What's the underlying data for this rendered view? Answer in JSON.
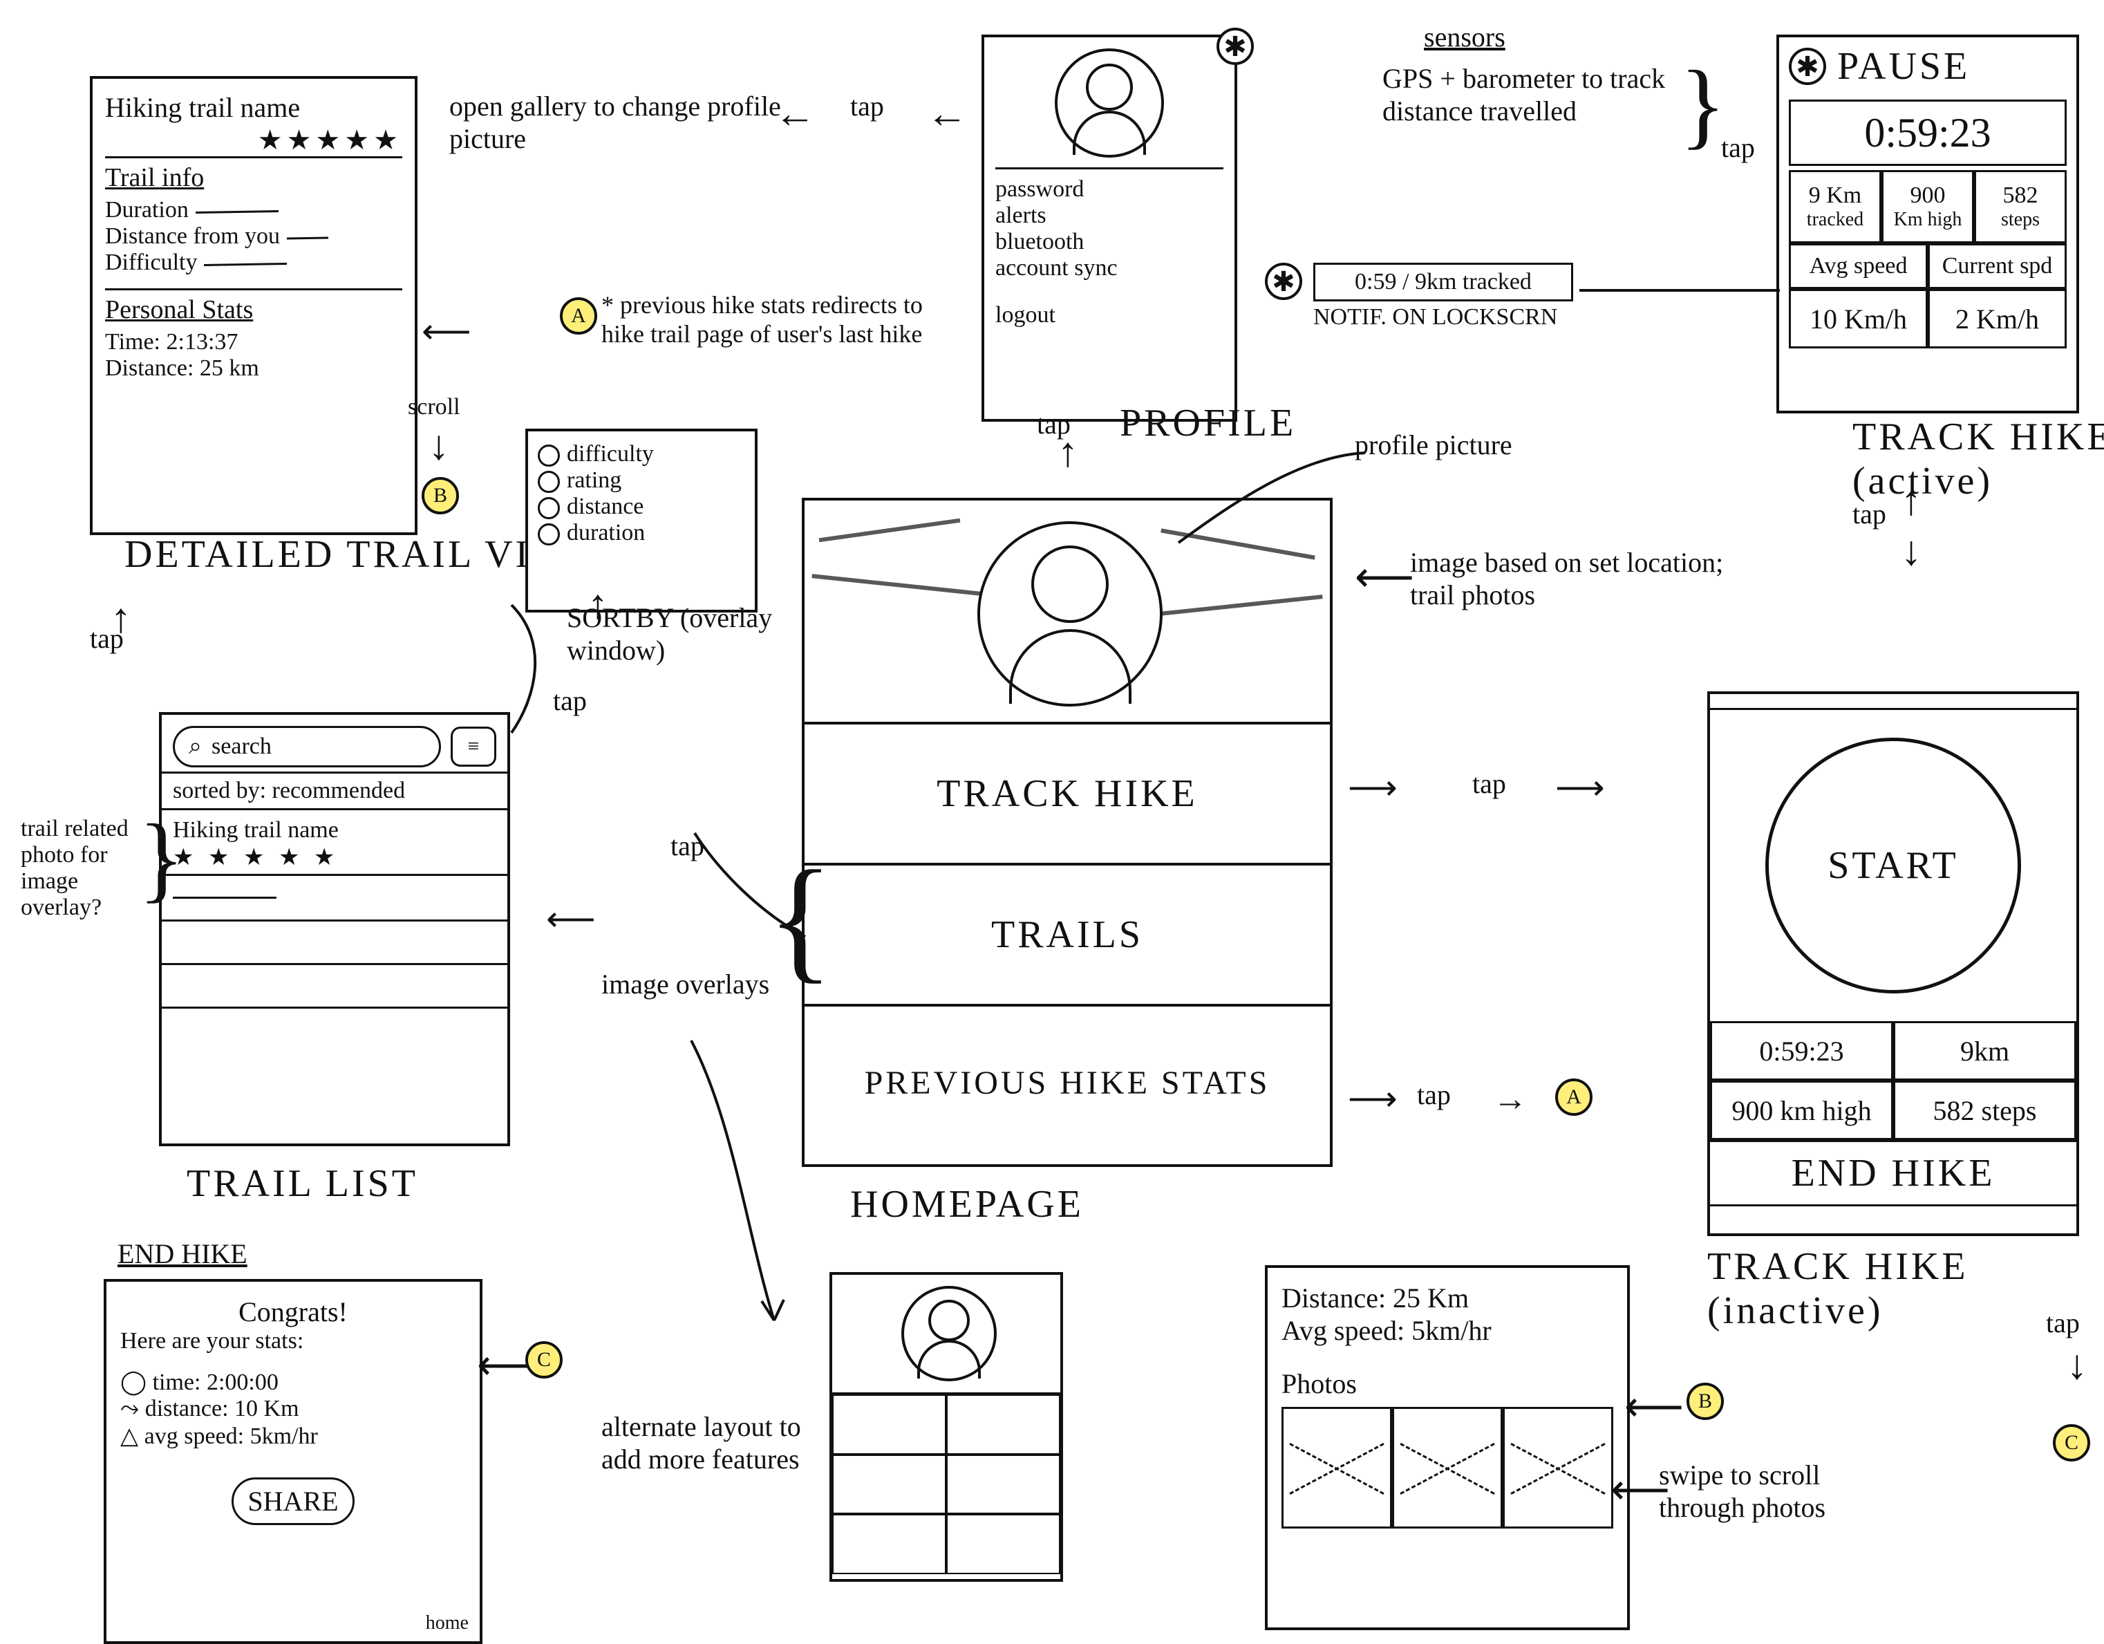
{
  "detail": {
    "title": "Hiking trail name",
    "stars": "★★★★★",
    "info_h": "Trail info",
    "duration": "Duration",
    "distfrom": "Distance from you",
    "difficulty": "Difficulty",
    "ps_h": "Personal Stats",
    "time": "Time: 2:13:37",
    "dist": "Distance: 25 km",
    "caption": "DETAILED TRAIL VIEW",
    "scroll": "scroll"
  },
  "sortby": {
    "o1": "difficulty",
    "o2": "rating",
    "o3": "distance",
    "o4": "duration",
    "caption": "SORTBY (overlay window)"
  },
  "list": {
    "search": "search",
    "sorted": "sorted by: recommended",
    "item": "Hiking trail name",
    "stars": "★ ★ ★ ★ ★",
    "caption": "TRAIL LIST",
    "sidenote": "trail related photo for image overlay?"
  },
  "endhike": {
    "h": "END HIKE",
    "congrats": "Congrats!",
    "sub": "Here are your stats:",
    "time": "time: 2:00:00",
    "dist": "distance: 10 Km",
    "avg": "avg speed: 5km/hr",
    "share": "SHARE",
    "home": "home"
  },
  "profile": {
    "p1": "password",
    "p2": "alerts",
    "p3": "bluetooth",
    "p4": "account sync",
    "p5": "logout",
    "caption": "PROFILE"
  },
  "home": {
    "b1": "TRACK HIKE",
    "b2": "TRAILS",
    "b3": "PREVIOUS HIKE STATS",
    "caption": "HOMEPAGE"
  },
  "altlayout": "alternate layout to add more features",
  "notes": {
    "opengallery": "open gallery to change profile picture",
    "tap": "tap",
    "prevhike": "* previous hike stats redirects to hike trail page of user's last hike",
    "imageoverlays": "image overlays",
    "sensors_h": "sensors",
    "sensors": "GPS + barometer to track distance travelled",
    "imagebased": "image based on set location; trail photos",
    "profilepic": "profile picture",
    "swipe": "swipe to scroll through photos",
    "notif": "NOTIF. ON LOCKSCRN",
    "notifval": "0:59 / 9km tracked"
  },
  "active": {
    "pause": "PAUSE",
    "timer": "0:59:23",
    "c1a": "9 Km",
    "c1b": "tracked",
    "c2a": "900",
    "c2b": "Km high",
    "c3a": "582",
    "c3b": "steps",
    "r2a": "Avg speed",
    "r2b": "Current spd",
    "r3a": "10 Km/h",
    "r3b": "2 Km/h",
    "caption": "TRACK HIKE (active)"
  },
  "inactive": {
    "start": "START",
    "t1": "0:59:23",
    "t2": "9km",
    "t3": "900 km high",
    "t4": "582 steps",
    "end": "END HIKE",
    "caption": "TRACK HIKE (inactive)"
  },
  "prevstats": {
    "dist": "Distance: 25 Km",
    "avg": "Avg speed: 5km/hr",
    "photos_h": "Photos"
  },
  "badges": {
    "A": "A",
    "B": "B",
    "C": "C"
  }
}
